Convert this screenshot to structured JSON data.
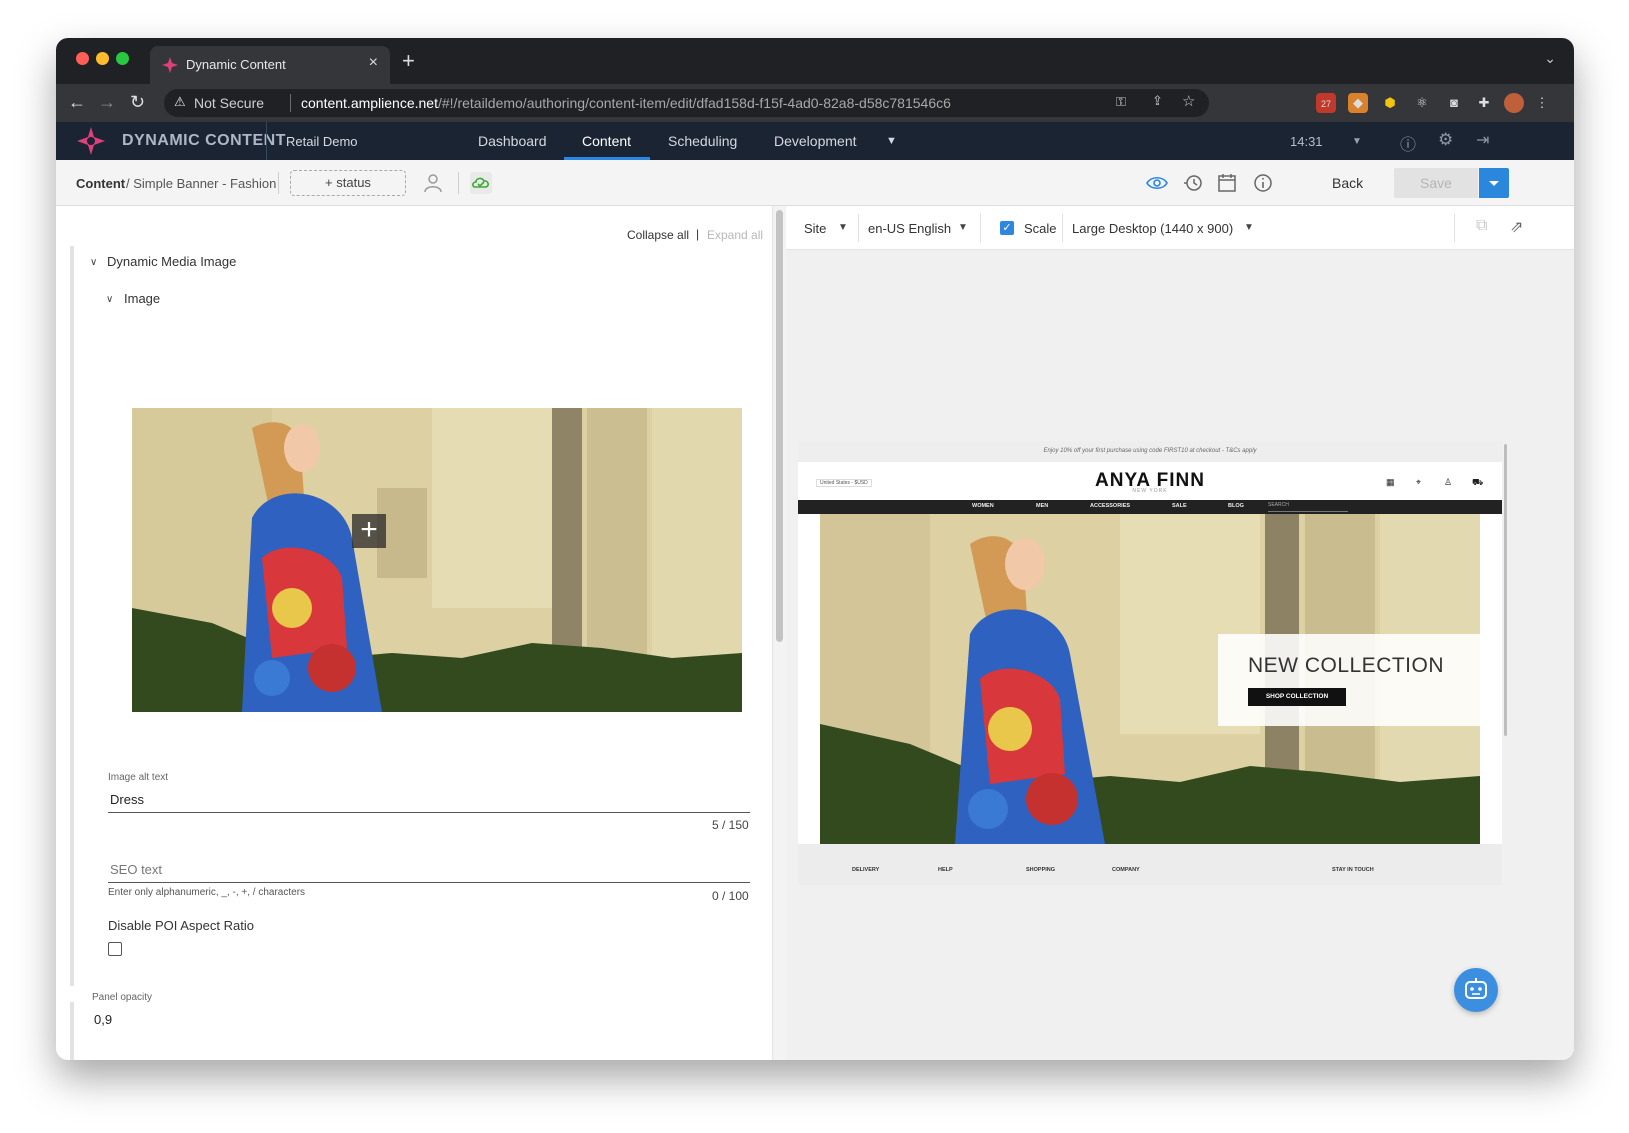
{
  "browser": {
    "tab_title": "Dynamic Content",
    "new_tab": "+",
    "security_label": "Not Secure",
    "url_host": "content.amplience.net",
    "url_path": "/#!/retaildemo/authoring/content-item/edit/dfad158d-f15f-4ad0-82a8-d58c781546c6",
    "extension_badge": "27"
  },
  "app": {
    "brand": "DYNAMIC CONTENT",
    "hub": "Retail Demo",
    "menu": [
      "Dashboard",
      "Content",
      "Scheduling",
      "Development"
    ],
    "active_menu": "Content",
    "time": "14:31"
  },
  "toolbar": {
    "breadcrumb_root": "Content",
    "breadcrumb_item": "/ Simple Banner - Fashion",
    "status_button": "+ status",
    "back": "Back",
    "save": "Save"
  },
  "editor": {
    "collapse_all": "Collapse all",
    "separator": "|",
    "expand_all": "Expand all",
    "section": "Dynamic Media Image",
    "subsection": "Image",
    "alt_label": "Image alt text",
    "alt_value": "Dress",
    "alt_counter": "5 / 150",
    "seo_placeholder": "SEO text",
    "seo_hint": "Enter only alphanumeric, _, -, +, / characters",
    "seo_counter": "0 / 100",
    "poi_label": "Disable POI Aspect Ratio",
    "opacity_label": "Panel opacity",
    "opacity_value": "0,9"
  },
  "preview": {
    "site": "Site",
    "locale": "en-US English",
    "scale": "Scale",
    "device": "Large Desktop (1440 x 900)",
    "promo": "Enjoy 10% off your first purchase using code FIRST10 at checkout - T&Cs apply",
    "store_locale": "United States - $USD",
    "logo": "ANYA FINN",
    "logo_sub": "NEW YORK",
    "nav": [
      "WOMEN",
      "MEN",
      "ACCESSORIES",
      "SALE",
      "BLOG"
    ],
    "search": "SEARCH",
    "hero_title": "NEW COLLECTION",
    "hero_button": "SHOP COLLECTION",
    "footer": [
      "DELIVERY",
      "HELP",
      "SHOPPING",
      "COMPANY",
      "STAY IN TOUCH"
    ]
  },
  "colors": {
    "accent": "#2a87e4",
    "nav_bg": "#1b2433",
    "brand_pink": "#e0407a"
  }
}
